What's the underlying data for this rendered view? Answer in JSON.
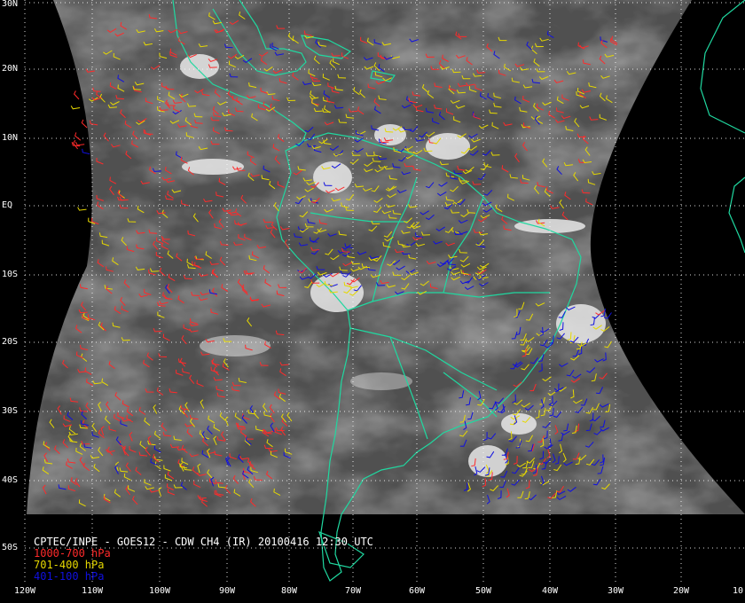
{
  "title": "CPTEC/INPE - GOES12 - CDW CH4 (IR) 20100416 12:30 UTC",
  "legend": [
    {
      "label": "1000-700 hPa",
      "color": "#ff2a2a"
    },
    {
      "label": "701-400 hPa",
      "color": "#e6d800"
    },
    {
      "label": "401-100 hPa",
      "color": "#1010e0"
    }
  ],
  "lat_labels": [
    "30N",
    "20N",
    "10N",
    "EQ",
    "10S",
    "20S",
    "30S",
    "40S",
    "50S"
  ],
  "lon_labels": [
    "120W",
    "110W",
    "100W",
    "90W",
    "80W",
    "70W",
    "60W",
    "50W",
    "40W",
    "30W",
    "20W",
    "10"
  ],
  "colors": {
    "coast": "#20d8a0",
    "grid": "#ffffff",
    "background": "#000000"
  }
}
